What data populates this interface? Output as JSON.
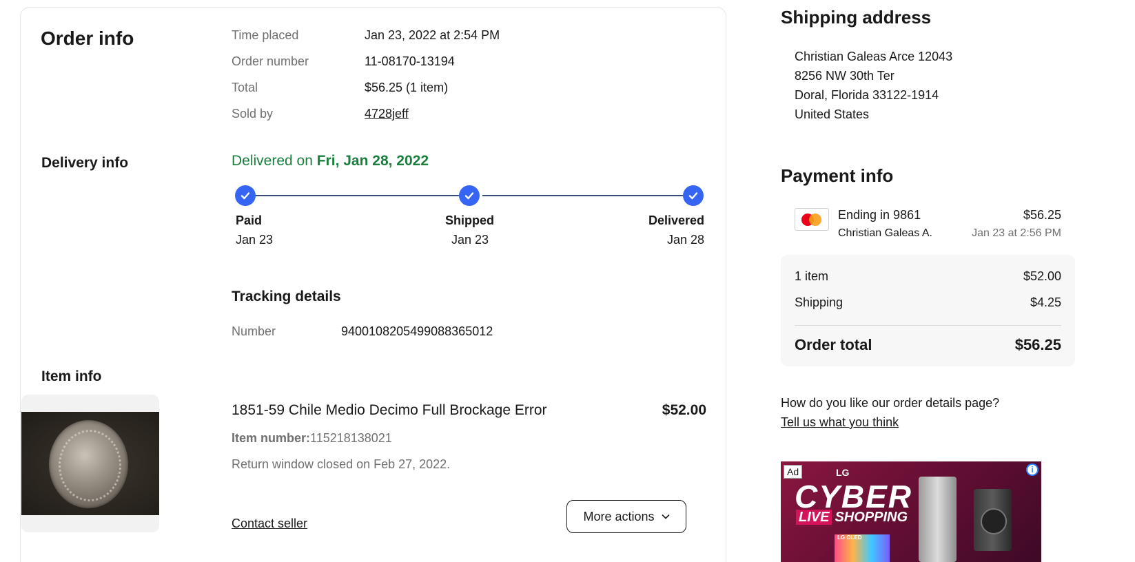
{
  "order_info": {
    "heading": "Order info",
    "rows": [
      {
        "label": "Time placed",
        "value": "Jan 23, 2022 at 2:54 PM"
      },
      {
        "label": "Order number",
        "value": "11-08170-13194"
      },
      {
        "label": "Total",
        "value": "$56.25 (1 item)"
      },
      {
        "label": "Sold by",
        "value": "4728jeff"
      }
    ]
  },
  "delivery_info": {
    "heading": "Delivery info",
    "status_prefix": "Delivered on ",
    "status_date": "Fri, Jan 28, 2022",
    "status_color": "#1a7f3c",
    "progress_color": "#3665f3",
    "steps": [
      {
        "title": "Paid",
        "date": "Jan 23"
      },
      {
        "title": "Shipped",
        "date": "Jan 23"
      },
      {
        "title": "Delivered",
        "date": "Jan 28"
      }
    ],
    "tracking_heading": "Tracking details",
    "tracking_label": "Number",
    "tracking_number": "9400108205499088365012"
  },
  "item_info": {
    "heading": "Item info",
    "title": "1851-59 Chile Medio Decimo Full Brockage Error",
    "price": "$52.00",
    "item_number_label": "Item number:",
    "item_number": "115218138021",
    "return_note": "Return window closed on Feb 27, 2022.",
    "contact_seller": "Contact seller",
    "more_actions": "More actions"
  },
  "shipping_address": {
    "heading": "Shipping address",
    "lines": [
      "Christian Galeas Arce 12043",
      "8256 NW 30th Ter",
      "Doral, Florida 33122-1914",
      "United States"
    ]
  },
  "payment_info": {
    "heading": "Payment info",
    "card_icon": "mastercard-icon",
    "card_text": "Ending in 9861",
    "card_holder": "Christian Galeas A.",
    "amount": "$56.25",
    "timestamp": "Jan 23 at 2:56 PM",
    "summary": {
      "items_label": "1 item",
      "items_value": "$52.00",
      "shipping_label": "Shipping",
      "shipping_value": "$4.25",
      "total_label": "Order total",
      "total_value": "$56.25"
    }
  },
  "feedback": {
    "question": "How do you like our order details page?",
    "link": "Tell us what you think"
  },
  "ad": {
    "badge": "Ad",
    "brand": "LG",
    "headline": "CYBER",
    "live": "LIVE",
    "subline": "SHOPPING",
    "tv_label": "LG OLED",
    "info_icon": "info-icon"
  }
}
